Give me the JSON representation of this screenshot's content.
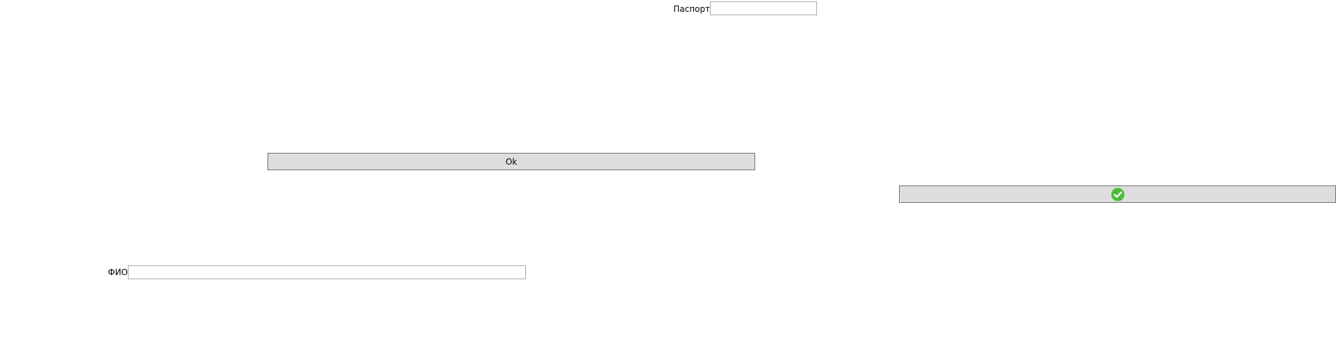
{
  "form": {
    "passport": {
      "label": "Паспорт",
      "value": "",
      "placeholder": ""
    },
    "ok_button": {
      "label": "Ok"
    },
    "confirm_button": {
      "icon": "check-circle-icon",
      "icon_color": "#4cbb3a"
    },
    "fio": {
      "label": "ФИО",
      "value": "",
      "placeholder": ""
    }
  }
}
